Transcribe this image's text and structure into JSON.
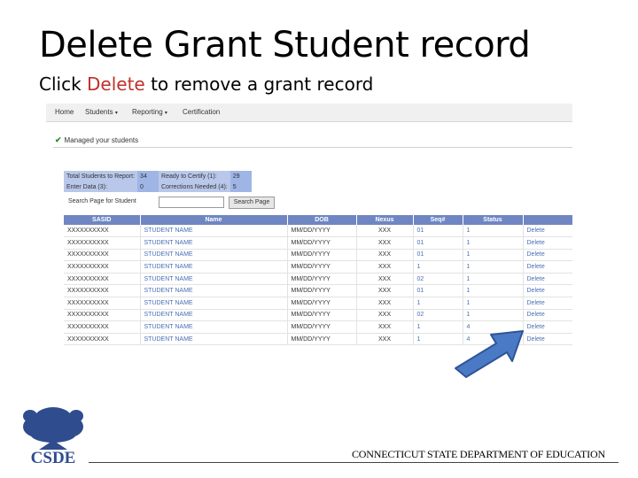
{
  "slide": {
    "title": "Delete Grant Student record",
    "subtitle_before": "Click ",
    "subtitle_highlight": "Delete",
    "subtitle_after": " to remove a grant record"
  },
  "nav": {
    "home": "Home",
    "students": "Students",
    "reporting": "Reporting",
    "certification": "Certification",
    "caret": "▾"
  },
  "managed": {
    "check": "✔",
    "label": "Managed your students"
  },
  "stats": {
    "total_label": "Total Students to Report:",
    "total_value": "34",
    "ready_label": "Ready to Certify (1):",
    "ready_value": "29",
    "enter_label": "Enter Data (3):",
    "enter_value": "0",
    "corrections_label": "Corrections Needed (4):",
    "corrections_value": "5"
  },
  "search": {
    "label": "Search Page for Student",
    "button": "Search Page"
  },
  "table": {
    "headers": [
      "SASID",
      "Name",
      "DOB",
      "Nexus",
      "Seq#",
      "Status",
      ""
    ],
    "rows": [
      [
        "XXXXXXXXXX",
        "STUDENT NAME",
        "MM/DD/YYYY",
        "XXX",
        "01",
        "1",
        "Delete"
      ],
      [
        "XXXXXXXXXX",
        "STUDENT NAME",
        "MM/DD/YYYY",
        "XXX",
        "01",
        "1",
        "Delete"
      ],
      [
        "XXXXXXXXXX",
        "STUDENT NAME",
        "MM/DD/YYYY",
        "XXX",
        "01",
        "1",
        "Delete"
      ],
      [
        "XXXXXXXXXX",
        "STUDENT NAME",
        "MM/DD/YYYY",
        "XXX",
        "1",
        "1",
        "Delete"
      ],
      [
        "XXXXXXXXXX",
        "STUDENT NAME",
        "MM/DD/YYYY",
        "XXX",
        "02",
        "1",
        "Delete"
      ],
      [
        "XXXXXXXXXX",
        "STUDENT NAME",
        "MM/DD/YYYY",
        "XXX",
        "01",
        "1",
        "Delete"
      ],
      [
        "XXXXXXXXXX",
        "STUDENT NAME",
        "MM/DD/YYYY",
        "XXX",
        "1",
        "1",
        "Delete"
      ],
      [
        "XXXXXXXXXX",
        "STUDENT NAME",
        "MM/DD/YYYY",
        "XXX",
        "02",
        "1",
        "Delete"
      ],
      [
        "XXXXXXXXXX",
        "STUDENT NAME",
        "MM/DD/YYYY",
        "XXX",
        "1",
        "4",
        "Delete"
      ],
      [
        "XXXXXXXXXX",
        "STUDENT NAME",
        "MM/DD/YYYY",
        "XXX",
        "1",
        "4",
        "Delete"
      ]
    ]
  },
  "footer": {
    "logo_text": "CSDE",
    "org": "CONNECTICUT STATE DEPARTMENT OF EDUCATION"
  },
  "colors": {
    "highlight": "#c0302a",
    "table_header": "#6f86c3",
    "link": "#4a6fb5",
    "arrow": "#4a7ac6",
    "logo": "#2f4c8e"
  }
}
